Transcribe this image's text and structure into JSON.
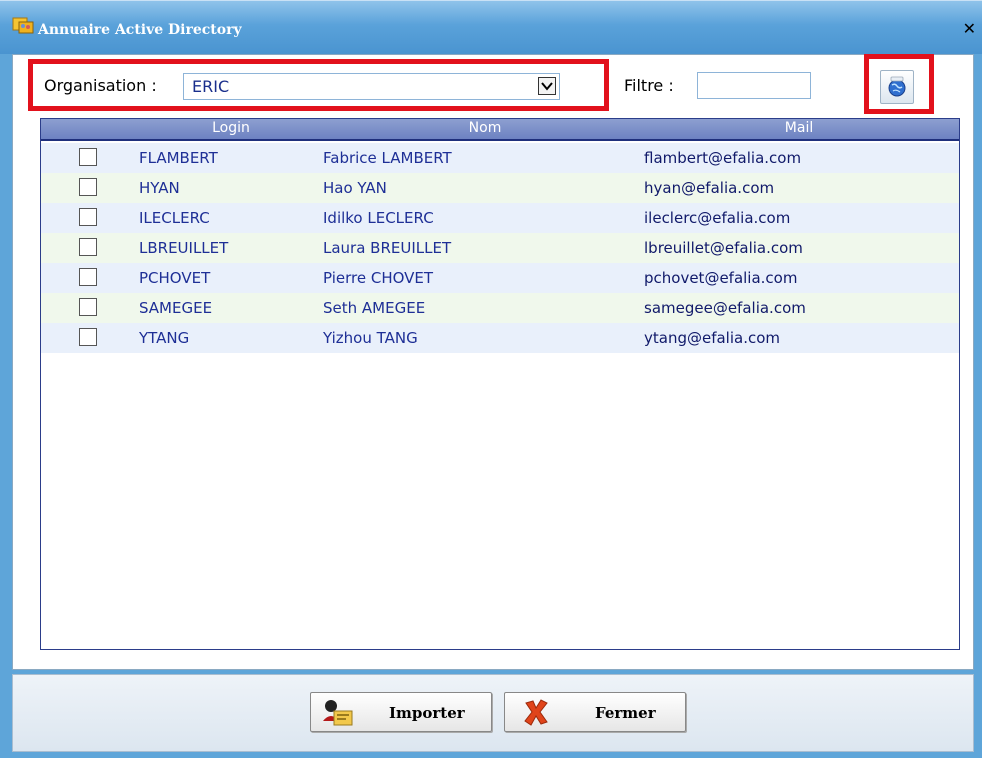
{
  "window": {
    "title": "Annuaire Active Directory",
    "close_symbol": "✕"
  },
  "filters": {
    "organisation_label": "Organisation :",
    "organisation_value": "ERIC",
    "filtre_label": "Filtre :",
    "filtre_value": ""
  },
  "table": {
    "columns": [
      "Login",
      "Nom",
      "Mail"
    ],
    "rows": [
      {
        "login": "FLAMBERT",
        "nom": "Fabrice LAMBERT",
        "mail": "flambert@efalia.com",
        "checked": false
      },
      {
        "login": "HYAN",
        "nom": "Hao YAN",
        "mail": "hyan@efalia.com",
        "checked": false
      },
      {
        "login": "ILECLERC",
        "nom": "Idilko LECLERC",
        "mail": "ileclerc@efalia.com",
        "checked": false
      },
      {
        "login": "LBREUILLET",
        "nom": "Laura BREUILLET",
        "mail": "lbreuillet@efalia.com",
        "checked": false
      },
      {
        "login": "PCHOVET",
        "nom": "Pierre CHOVET",
        "mail": "pchovet@efalia.com",
        "checked": false
      },
      {
        "login": "SAMEGEE",
        "nom": "Seth AMEGEE",
        "mail": "samegee@efalia.com",
        "checked": false
      },
      {
        "login": "YTANG",
        "nom": "Yizhou TANG",
        "mail": "ytang@efalia.com",
        "checked": false
      }
    ]
  },
  "footer": {
    "import_label": "Importer",
    "close_label": "Fermer"
  },
  "icons": {
    "title": "directory-icon",
    "refresh": "globe-refresh-icon",
    "import": "user-import-icon",
    "close": "red-x-icon"
  },
  "colors": {
    "highlight": "#e2111c",
    "header_bar": "#5aa2da",
    "link_text": "#1e2f96"
  }
}
